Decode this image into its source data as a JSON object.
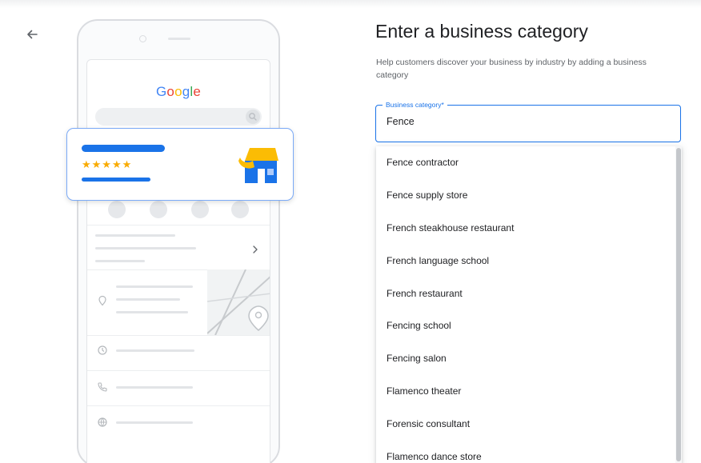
{
  "nav": {
    "back_icon": "arrow-left-icon"
  },
  "illustration": {
    "logo_letters": [
      "G",
      "o",
      "o",
      "g",
      "l",
      "e"
    ],
    "logo_colors": [
      "#4285f4",
      "#ea4335",
      "#fbbc05",
      "#4285f4",
      "#34a853",
      "#ea4335"
    ],
    "card_rating": "★★★★★",
    "store_icon": "storefront-icon",
    "accent_color": "#1a73e8",
    "star_color": "#f9ab00"
  },
  "form": {
    "title": "Enter a business category",
    "description": "Help customers discover your business by industry by adding a business category",
    "category_label": "Business category*",
    "category_value": "Fence"
  },
  "suggestions": [
    "Fence contractor",
    "Fence supply store",
    "French steakhouse restaurant",
    "French language school",
    "French restaurant",
    "Fencing school",
    "Fencing salon",
    "Flamenco theater",
    "Forensic consultant",
    "Flamenco dance store"
  ]
}
